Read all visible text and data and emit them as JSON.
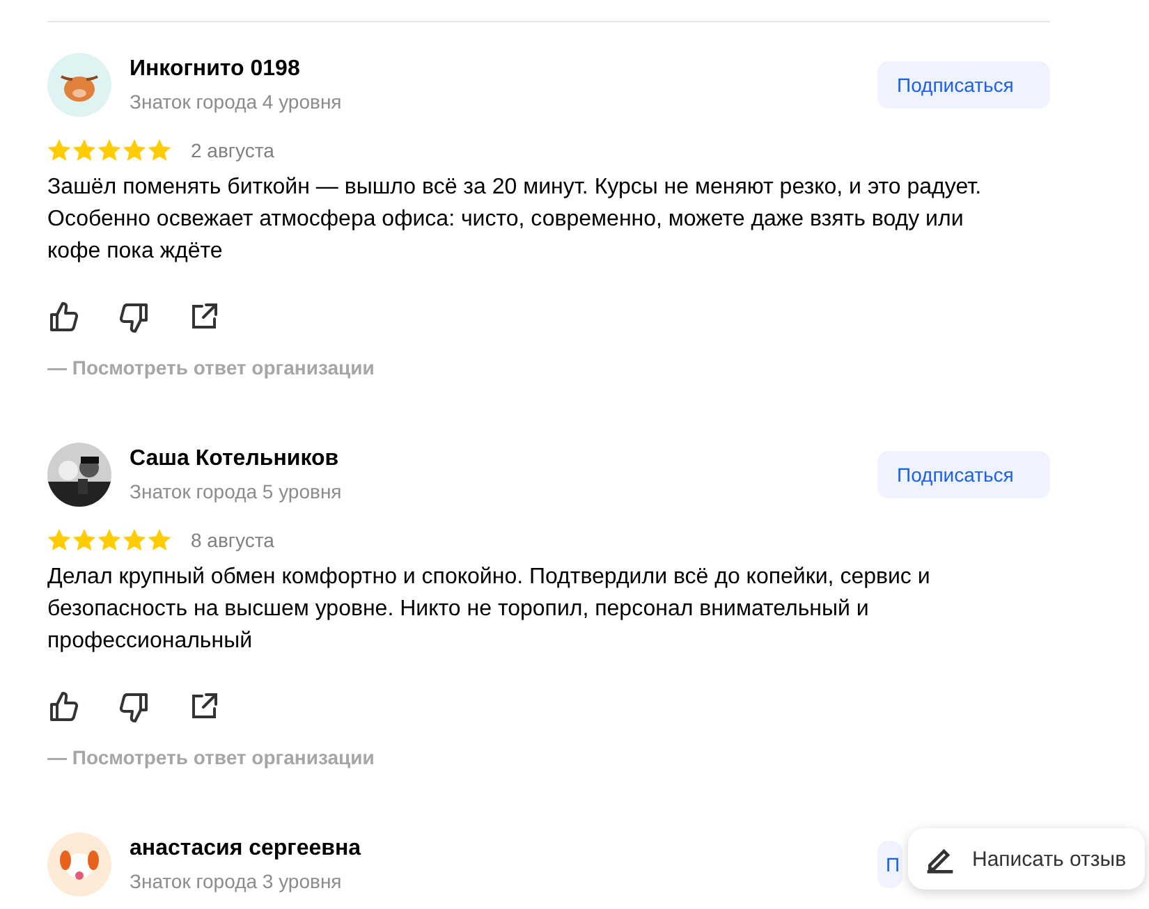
{
  "reviews": [
    {
      "author": "Инкогнито 0198",
      "level": "Знаток города 4 уровня",
      "avatar": {
        "kind": "bull"
      },
      "subscribe": "Подписаться",
      "stars": 5,
      "date": "2 августа",
      "text": "Зашёл поменять биткойн — вышло всё за 20 минут. Курсы не меняют резко, и это радует. Особенно освежает атмосфера офиса: чисто, современно, можете даже взять воду или кофе пока ждёте",
      "reply_link": "— Посмотреть ответ организации"
    },
    {
      "author": "Саша Котельников",
      "level": "Знаток города 5 уровня",
      "subscribe": "Подписаться",
      "stars": 5,
      "date": "8 августа",
      "text": "Делал крупный обмен комфортно и спокойно. Подтвердили всё до копейки, сервис и безопасность на высшем уровне. Никто не торопил, персонал внимательный и профессиональный",
      "reply_link": "— Посмотреть ответ организации"
    },
    {
      "author": "анастасия сергеевна",
      "level": "Знаток города 3 уровня",
      "avatar": {
        "kind": "dog"
      },
      "subscribe": "П",
      "subscribe_partly_hidden": true
    }
  ],
  "write_review": {
    "label": "Написать отзыв"
  }
}
